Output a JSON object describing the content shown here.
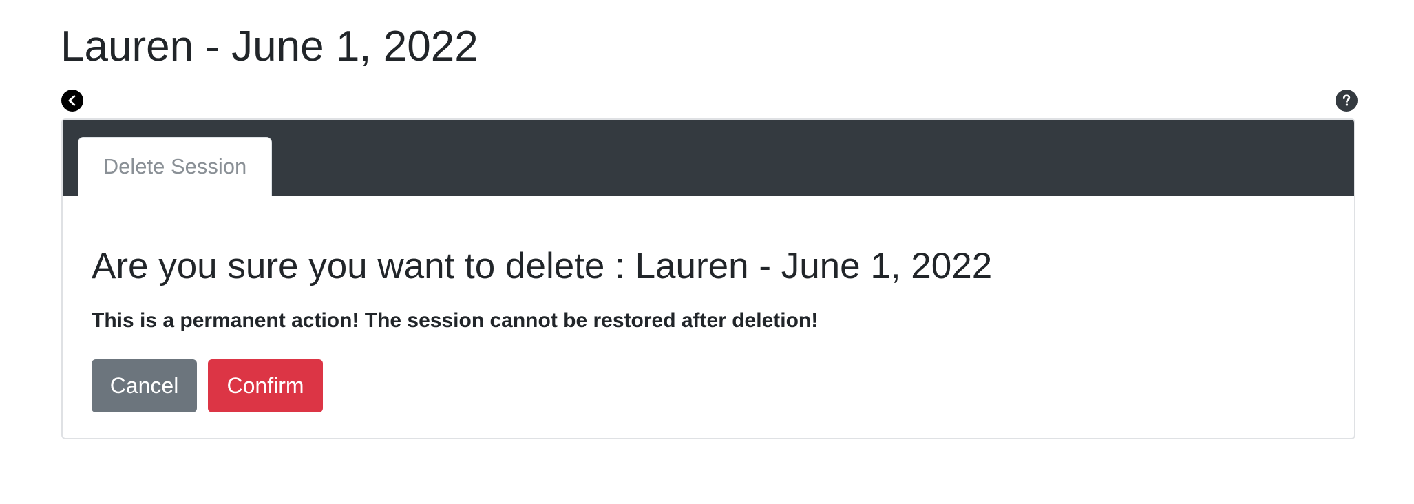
{
  "page": {
    "title": "Lauren - June 1, 2022"
  },
  "icons": {
    "back": "chevron-left-circle-icon",
    "help": "question-circle-icon"
  },
  "tabs": [
    {
      "label": "Delete Session",
      "active": true
    }
  ],
  "dialog": {
    "heading": "Are you sure you want to delete : Lauren - June 1, 2022",
    "warning": "This is a permanent action! The session cannot be restored after deletion!",
    "cancel_label": "Cancel",
    "confirm_label": "Confirm"
  },
  "colors": {
    "header_bg": "#343a40",
    "cancel_bg": "#6c757d",
    "confirm_bg": "#dc3545",
    "tab_text": "#8a9096"
  }
}
